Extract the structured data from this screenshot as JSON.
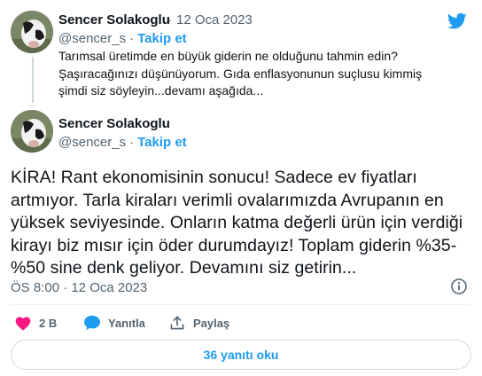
{
  "parent_tweet": {
    "author_name": "Sencer Solakoglu",
    "date": "12 Oca 2023",
    "handle": "@sencer_s",
    "separator": "·",
    "follow_label": "Takip et",
    "text_lines": [
      "Tarımsal üretimde en büyük giderin ne olduğunu tahmin edin?",
      "Şaşıracağınızı düşünüyorum. Gıda enflasyonunun suçlusu kimmiş",
      "şimdi siz söyleyin...devamı aşağıda..."
    ]
  },
  "main_tweet": {
    "author_name": "Sencer Solakoglu",
    "handle": "@sencer_s",
    "separator": "·",
    "follow_label": "Takip et",
    "text_lines": [
      "KİRA! Rant ekonomisinin sonucu! Sadece ev fiyatları",
      "artmıyor. Tarla kiraları verimli ovalarımızda  Avrupanın en",
      "yüksek seviyesinde. Onların katma değerli ürün için verdiği",
      "kirayı biz mısır için öder durumdayız! Toplam giderin %35-",
      "%50 sine denk geliyor. Devamını siz getirin..."
    ],
    "timestamp": "ÖS 8:00 · 12 Oca 2023"
  },
  "actions": {
    "like_count": "2 B",
    "reply_label": "Yanıtla",
    "share_label": "Paylaş"
  },
  "replies_button_label": "36 yanıtı oku",
  "colors": {
    "accent": "#1d9bf0",
    "like": "#f91880",
    "muted": "#536471",
    "text": "#0f1419",
    "border": "#cfd9de"
  },
  "icons": [
    "twitter-bird-icon",
    "info-icon",
    "heart-icon",
    "reply-bubble-icon",
    "share-icon"
  ]
}
